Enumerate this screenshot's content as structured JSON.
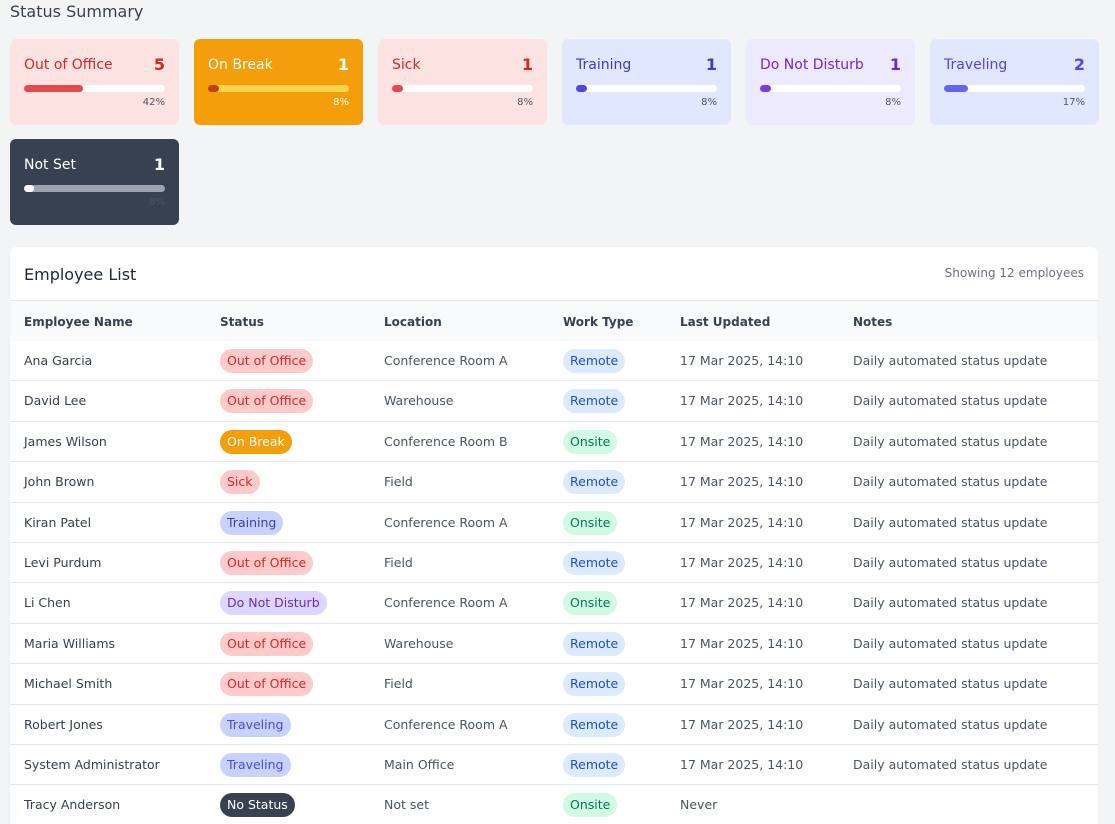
{
  "summary": {
    "title": "Status Summary",
    "cards": [
      {
        "label": "Out of Office",
        "count": "5",
        "percent": "42%",
        "fill": 0.42,
        "bg": "#fde2e2",
        "fg": "#dc2626",
        "track": "#ffffff",
        "bar": "#e5484d",
        "pctColor": "#4b5563"
      },
      {
        "label": "On Break",
        "count": "1",
        "percent": "8%",
        "fill": 0.08,
        "bg": "#f59e0b",
        "fg": "#ffffff",
        "track": "#fcd34d",
        "bar": "#c2410c",
        "pctColor": "#ffffff"
      },
      {
        "label": "Sick",
        "count": "1",
        "percent": "8%",
        "fill": 0.08,
        "bg": "#fde2e2",
        "fg": "#dc2626",
        "track": "#ffffff",
        "bar": "#e5484d",
        "pctColor": "#4b5563"
      },
      {
        "label": "Training",
        "count": "1",
        "percent": "8%",
        "fill": 0.08,
        "bg": "#e0e7ff",
        "fg": "#4338ca",
        "track": "#ffffff",
        "bar": "#4f46e5",
        "pctColor": "#4b5563"
      },
      {
        "label": "Do Not Disturb",
        "count": "1",
        "percent": "8%",
        "fill": 0.08,
        "bg": "#ede9fe",
        "fg": "#6d28d9",
        "track": "#ffffff",
        "bar": "#7c3aed",
        "pctColor": "#4b5563"
      },
      {
        "label": "Traveling",
        "count": "2",
        "percent": "17%",
        "fill": 0.17,
        "bg": "#e0e7ff",
        "fg": "#4f46e5",
        "track": "#ffffff",
        "bar": "#6366f1",
        "pctColor": "#4b5563"
      },
      {
        "label": "Not Set",
        "count": "1",
        "percent": "8%",
        "fill": 0.04,
        "bg": "#374151",
        "fg": "#ffffff",
        "track": "#9ca3af",
        "bar": "#ffffff",
        "pctColor": "#4b5563"
      }
    ]
  },
  "employees": {
    "title": "Employee List",
    "count_text": "Showing 12 employees",
    "columns": [
      "Employee Name",
      "Status",
      "Location",
      "Work Type",
      "Last Updated",
      "Notes"
    ],
    "rows": [
      {
        "name": "Ana Garcia",
        "status": "Out of Office",
        "status_bg": "#fecaca",
        "status_fg": "#dc2626",
        "location": "Conference Room A",
        "work": "Remote",
        "updated": "17 Mar 2025, 14:10",
        "notes": "Daily automated status update"
      },
      {
        "name": "David Lee",
        "status": "Out of Office",
        "status_bg": "#fecaca",
        "status_fg": "#dc2626",
        "location": "Warehouse",
        "work": "Remote",
        "updated": "17 Mar 2025, 14:10",
        "notes": "Daily automated status update"
      },
      {
        "name": "James Wilson",
        "status": "On Break",
        "status_bg": "#f59e0b",
        "status_fg": "#ffffff",
        "location": "Conference Room B",
        "work": "Onsite",
        "updated": "17 Mar 2025, 14:10",
        "notes": "Daily automated status update"
      },
      {
        "name": "John Brown",
        "status": "Sick",
        "status_bg": "#fecaca",
        "status_fg": "#dc2626",
        "location": "Field",
        "work": "Remote",
        "updated": "17 Mar 2025, 14:10",
        "notes": "Daily automated status update"
      },
      {
        "name": "Kiran Patel",
        "status": "Training",
        "status_bg": "#c7d2fe",
        "status_fg": "#4338ca",
        "location": "Conference Room A",
        "work": "Onsite",
        "updated": "17 Mar 2025, 14:10",
        "notes": "Daily automated status update"
      },
      {
        "name": "Levi Purdum",
        "status": "Out of Office",
        "status_bg": "#fecaca",
        "status_fg": "#dc2626",
        "location": "Field",
        "work": "Remote",
        "updated": "17 Mar 2025, 14:10",
        "notes": "Daily automated status update"
      },
      {
        "name": "Li Chen",
        "status": "Do Not Disturb",
        "status_bg": "#ddd6fe",
        "status_fg": "#6d28d9",
        "location": "Conference Room A",
        "work": "Onsite",
        "updated": "17 Mar 2025, 14:10",
        "notes": "Daily automated status update"
      },
      {
        "name": "Maria Williams",
        "status": "Out of Office",
        "status_bg": "#fecaca",
        "status_fg": "#dc2626",
        "location": "Warehouse",
        "work": "Remote",
        "updated": "17 Mar 2025, 14:10",
        "notes": "Daily automated status update"
      },
      {
        "name": "Michael Smith",
        "status": "Out of Office",
        "status_bg": "#fecaca",
        "status_fg": "#dc2626",
        "location": "Field",
        "work": "Remote",
        "updated": "17 Mar 2025, 14:10",
        "notes": "Daily automated status update"
      },
      {
        "name": "Robert Jones",
        "status": "Traveling",
        "status_bg": "#c7d2fe",
        "status_fg": "#4f46e5",
        "location": "Conference Room A",
        "work": "Remote",
        "updated": "17 Mar 2025, 14:10",
        "notes": "Daily automated status update"
      },
      {
        "name": "System Administrator",
        "status": "Traveling",
        "status_bg": "#c7d2fe",
        "status_fg": "#4f46e5",
        "location": "Main Office",
        "work": "Remote",
        "updated": "17 Mar 2025, 14:10",
        "notes": "Daily automated status update"
      },
      {
        "name": "Tracy Anderson",
        "status": "No Status",
        "status_bg": "#374151",
        "status_fg": "#ffffff",
        "location": "Not set",
        "work": "Onsite",
        "updated": "Never",
        "notes": ""
      }
    ]
  },
  "work_colors": {
    "Remote": {
      "bg": "#dbeafe",
      "fg": "#1d4ed8"
    },
    "Onsite": {
      "bg": "#d1fae5",
      "fg": "#047857"
    }
  }
}
